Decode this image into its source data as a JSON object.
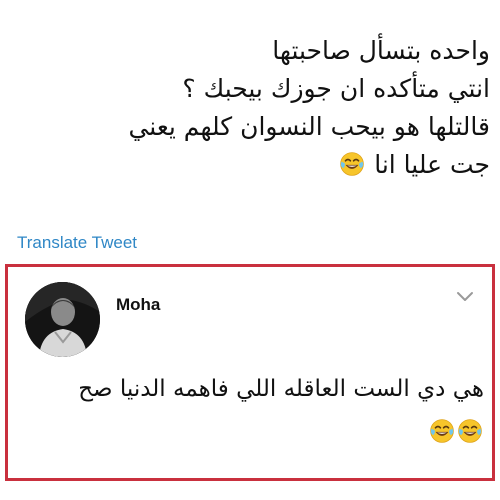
{
  "tweet": {
    "lines": [
      "واحده بتسأل صاحبتها",
      "انتي متأكده ان جوزك بيحبك ؟",
      "قالتلها هو بيحب النسوان كلهم يعني",
      "جت عليا انا"
    ],
    "emoji": "face-with-tears-of-joy-icon"
  },
  "translate": {
    "label": "Translate Tweet"
  },
  "reply": {
    "author_name": "Moha",
    "lines": [
      "هي دي الست العاقله اللي فاهمه الدنيا صح"
    ],
    "emoji": "face-with-tears-of-joy-icon",
    "emoji_count": 2
  },
  "colors": {
    "link": "#2f87c6",
    "highlight_border": "#c9303e",
    "text": "#111111"
  }
}
